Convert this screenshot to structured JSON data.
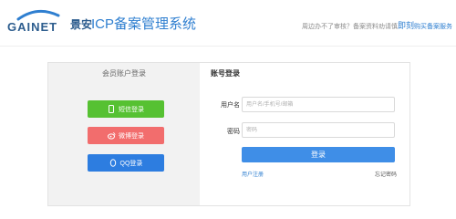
{
  "header": {
    "logo_text": "GAINET",
    "brand_cn": "景安",
    "system_title": "ICP备案管理系统",
    "notice_prefix": "周边办不了审核？备案资料劝请慎",
    "notice_highlight": "即刻",
    "notice_link": "购买备案服务"
  },
  "left": {
    "title": "会员账户登录",
    "buttons": {
      "sms": "短信登录",
      "weibo": "微博登录",
      "qq": "QQ登录"
    }
  },
  "right": {
    "title": "账号登录",
    "username_label": "用户名",
    "username_placeholder": "用户名/手机号/邮箱",
    "password_label": "密码",
    "password_placeholder": "密码",
    "login_button": "登录",
    "register_link": "用户注册",
    "forgot_link": "忘记密码"
  },
  "colors": {
    "brand_blue": "#2f7fd0",
    "sms_green": "#56c132",
    "weibo_red": "#f26d6d",
    "qq_blue": "#2d7de0",
    "login_blue": "#3f8ee7"
  }
}
